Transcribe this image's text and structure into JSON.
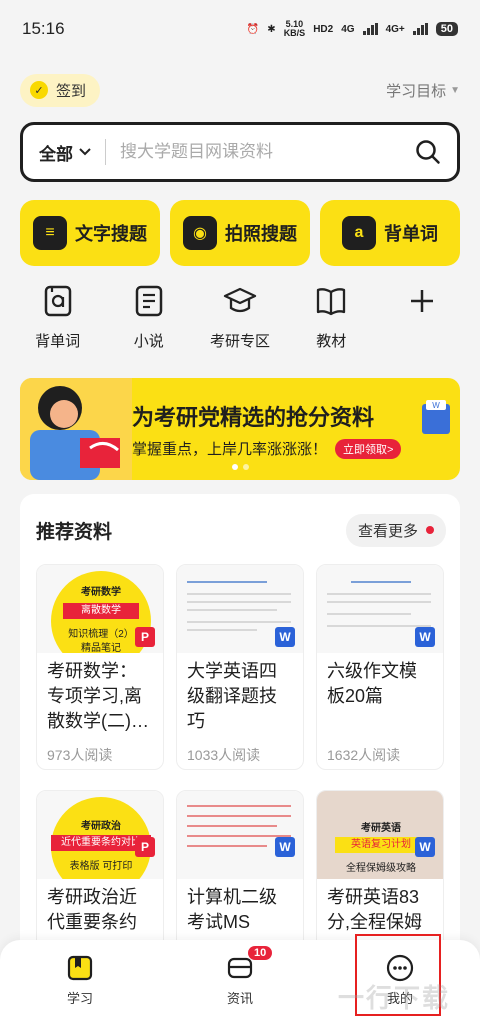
{
  "status": {
    "time": "15:16",
    "net_speed_top": "5.10",
    "net_speed_unit": "KB/S",
    "hd": "HD2",
    "net1": "4G",
    "net2": "4G+",
    "battery": "50"
  },
  "topbar": {
    "checkin_label": "签到",
    "goal_label": "学习目标"
  },
  "search": {
    "category": "全部",
    "placeholder": "搜大学题目网课资料"
  },
  "big_buttons": [
    {
      "label": "文字搜题",
      "icon": "text-search-icon"
    },
    {
      "label": "拍照搜题",
      "icon": "camera-icon"
    },
    {
      "label": "背单词",
      "icon": "word-book-icon"
    }
  ],
  "quick_items": [
    {
      "label": "背单词",
      "icon": "word-book-icon"
    },
    {
      "label": "小说",
      "icon": "novel-icon"
    },
    {
      "label": "考研专区",
      "icon": "graduate-cap-icon"
    },
    {
      "label": "教材",
      "icon": "textbook-icon"
    },
    {
      "label": "",
      "icon": "plus-icon"
    }
  ],
  "banner": {
    "title": "为考研党精选的抢分资料",
    "subtitle": "掌握重点，上岸几率涨涨涨！",
    "cta": "立即领取>"
  },
  "recommend": {
    "title": "推荐资料",
    "more_label": "查看更多",
    "docs": [
      {
        "title": "考研数学：专项学习,离散数学(二)…",
        "reads": "973人阅读",
        "thumb_top": "考研数学",
        "thumb_chip": "离散数学",
        "thumb_sub": "知识梳理（2）",
        "thumb_sub2": "精品笔记"
      },
      {
        "title": "大学英语四级翻译题技巧",
        "reads": "1033人阅读"
      },
      {
        "title": "六级作文模板20篇",
        "reads": "1632人阅读"
      },
      {
        "title": "考研政治近代重要条约",
        "reads": "",
        "thumb_top": "考研政治",
        "thumb_chip": "近代重要条约对比",
        "thumb_sub": "表格版 可打印"
      },
      {
        "title": "计算机二级考试MS",
        "reads": ""
      },
      {
        "title": "考研英语83分,全程保姆",
        "reads": "",
        "thumb_top": "考研英语",
        "thumb_chip": "英语复习计划",
        "thumb_sub": "全程保姆级攻略"
      }
    ]
  },
  "tabbar": [
    {
      "label": "学习",
      "icon": "book-icon"
    },
    {
      "label": "资讯",
      "icon": "news-icon",
      "badge": "10"
    },
    {
      "label": "我的",
      "icon": "more-circle-icon"
    }
  ],
  "watermark": "一行下载",
  "colors": {
    "accent": "#fbe014",
    "dark": "#1f1f1f",
    "red": "#e8233a",
    "word_blue": "#2b62d8"
  }
}
